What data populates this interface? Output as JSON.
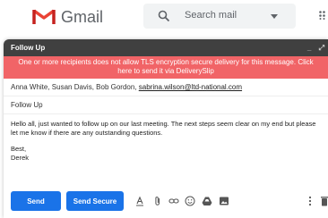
{
  "header": {
    "app_name": "Gmail",
    "search_placeholder": "Search mail"
  },
  "compose": {
    "title": "Follow Up",
    "warning": "One or more recipients does not allow TLS encryption secure delivery for this message. Click here to send it via DeliverySlip",
    "recipients_plain": "Anna White, Susan Davis, Bob Gordon, ",
    "recipients_link": "sabrina.wilson@ltd-national.com",
    "subject": "Follow Up",
    "body_line1": "Hello all, just wanted to follow up on our last meeting. The next steps seem clear on my end but please let me know if there are any outstanding questions.",
    "body_sign1": "Best,",
    "body_sign2": "Derek",
    "send_label": "Send",
    "send_secure_label": "Send Secure"
  },
  "colors": {
    "warning_bg": "#f16467",
    "button_blue": "#1a73e8",
    "header_dark": "#404040"
  }
}
